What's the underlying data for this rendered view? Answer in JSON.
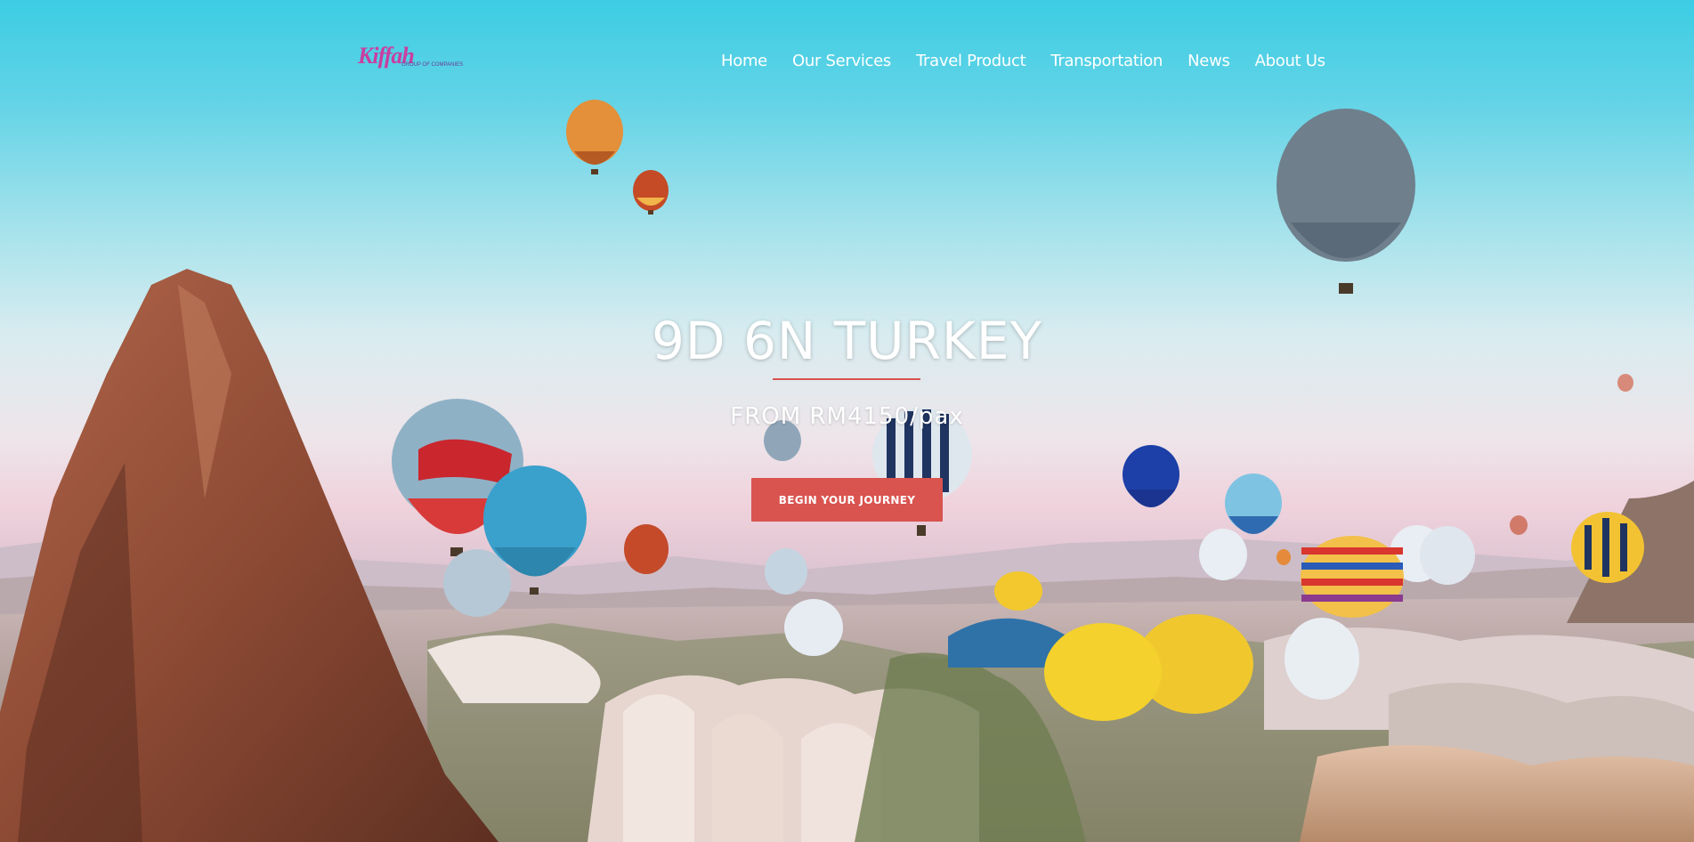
{
  "header": {
    "logo_main": "Kiffah",
    "logo_sub": "GROUP OF COMPANIES",
    "nav": [
      {
        "label": "Home"
      },
      {
        "label": "Our Services"
      },
      {
        "label": "Travel Product"
      },
      {
        "label": "Transportation"
      },
      {
        "label": "News"
      },
      {
        "label": "About Us"
      }
    ]
  },
  "hero": {
    "title": "9D 6N TURKEY",
    "subtitle": "FROM RM4150/pax",
    "cta_label": "BEGIN YOUR JOURNEY",
    "background_image": "cappadocia-hot-air-balloons"
  },
  "colors": {
    "accent": "#d9534f",
    "nav_text": "#ffffff",
    "sky_top": "#3ccde4",
    "logo_pink": "#c93ea0",
    "logo_orange": "#f39a2c"
  }
}
